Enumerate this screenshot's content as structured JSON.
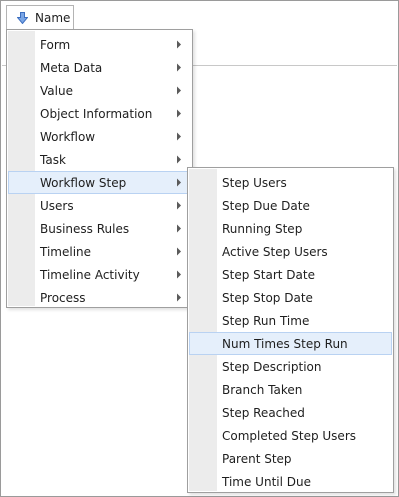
{
  "header": {
    "column_label": "Name",
    "sort_icon": "down-arrow-icon"
  },
  "main_menu": {
    "items": [
      {
        "label": "Form",
        "has_submenu": true
      },
      {
        "label": "Meta Data",
        "has_submenu": true
      },
      {
        "label": "Value",
        "has_submenu": true
      },
      {
        "label": "Object Information",
        "has_submenu": true
      },
      {
        "label": "Workflow",
        "has_submenu": true
      },
      {
        "label": "Task",
        "has_submenu": true
      },
      {
        "label": "Workflow Step",
        "has_submenu": true,
        "highlighted": true
      },
      {
        "label": "Users",
        "has_submenu": true
      },
      {
        "label": "Business Rules",
        "has_submenu": true
      },
      {
        "label": "Timeline",
        "has_submenu": true
      },
      {
        "label": "Timeline Activity",
        "has_submenu": true
      },
      {
        "label": "Process",
        "has_submenu": true
      }
    ]
  },
  "sub_menu": {
    "items": [
      {
        "label": "Step Users"
      },
      {
        "label": "Step Due Date"
      },
      {
        "label": "Running Step"
      },
      {
        "label": "Active Step Users"
      },
      {
        "label": "Step Start Date"
      },
      {
        "label": "Step Stop Date"
      },
      {
        "label": "Step Run Time"
      },
      {
        "label": "Num Times Step Run",
        "highlighted": true
      },
      {
        "label": "Step Description"
      },
      {
        "label": "Branch Taken"
      },
      {
        "label": "Step Reached"
      },
      {
        "label": "Completed Step Users"
      },
      {
        "label": "Parent Step"
      },
      {
        "label": "Time Until Due"
      }
    ]
  },
  "colors": {
    "highlight_bg": "#e5effb",
    "highlight_border": "#b9d2f2",
    "gutter": "#ececec",
    "arrow_blue": "#4a78c8"
  }
}
